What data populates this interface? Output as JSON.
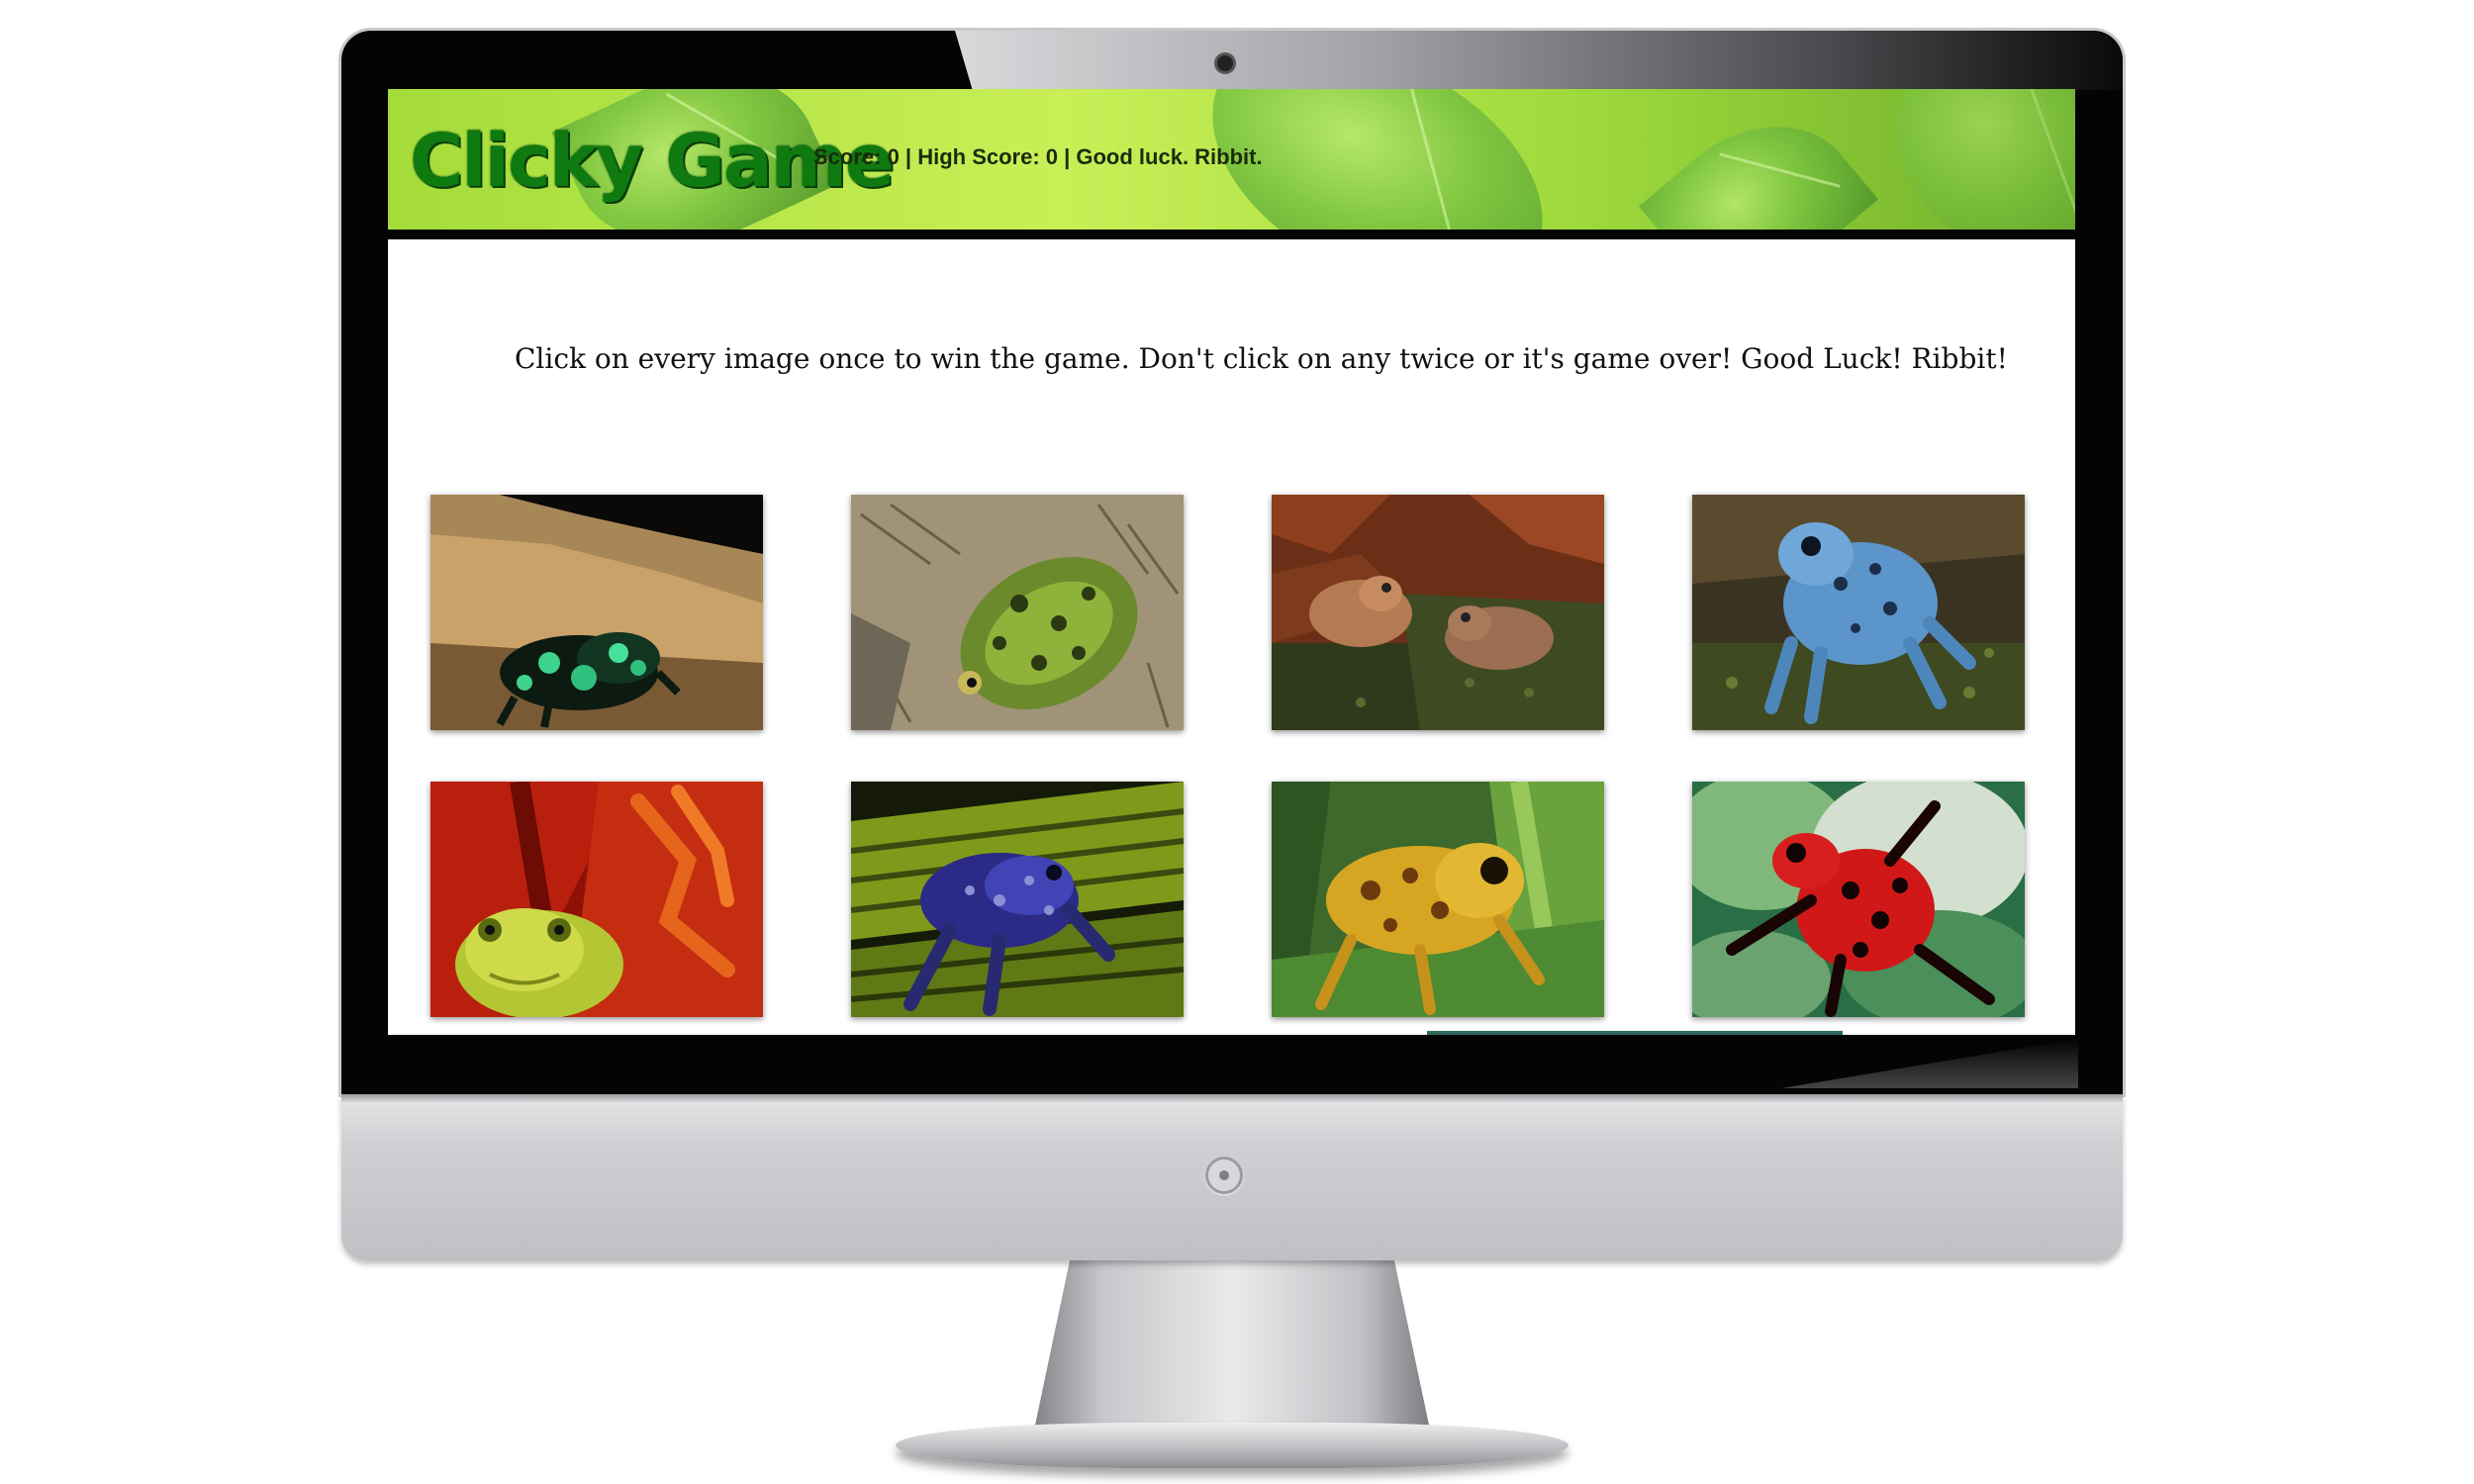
{
  "app": {
    "title": "Clicky Game",
    "status": "Score: 0 | High Score: 0 | Good luck. Ribbit."
  },
  "instructions": "Click on every image once to win the game. Don't click on any twice or it's game over! Good Luck! Ribbit!",
  "cards": [
    {
      "subject": "green-black-poison-dart-frog"
    },
    {
      "subject": "spotted-green-frog"
    },
    {
      "subject": "brown-wood-frogs"
    },
    {
      "subject": "blue-poison-dart-frog"
    },
    {
      "subject": "green-tree-frog-in-red-flower"
    },
    {
      "subject": "blue-dart-frog-on-leaf"
    },
    {
      "subject": "yellow-harlequin-frog"
    },
    {
      "subject": "red-black-poison-dart-frog"
    }
  ],
  "colors": {
    "header_green": "#a4dc3a",
    "logo_green": "#0e7a10",
    "bezel": "#040404"
  }
}
